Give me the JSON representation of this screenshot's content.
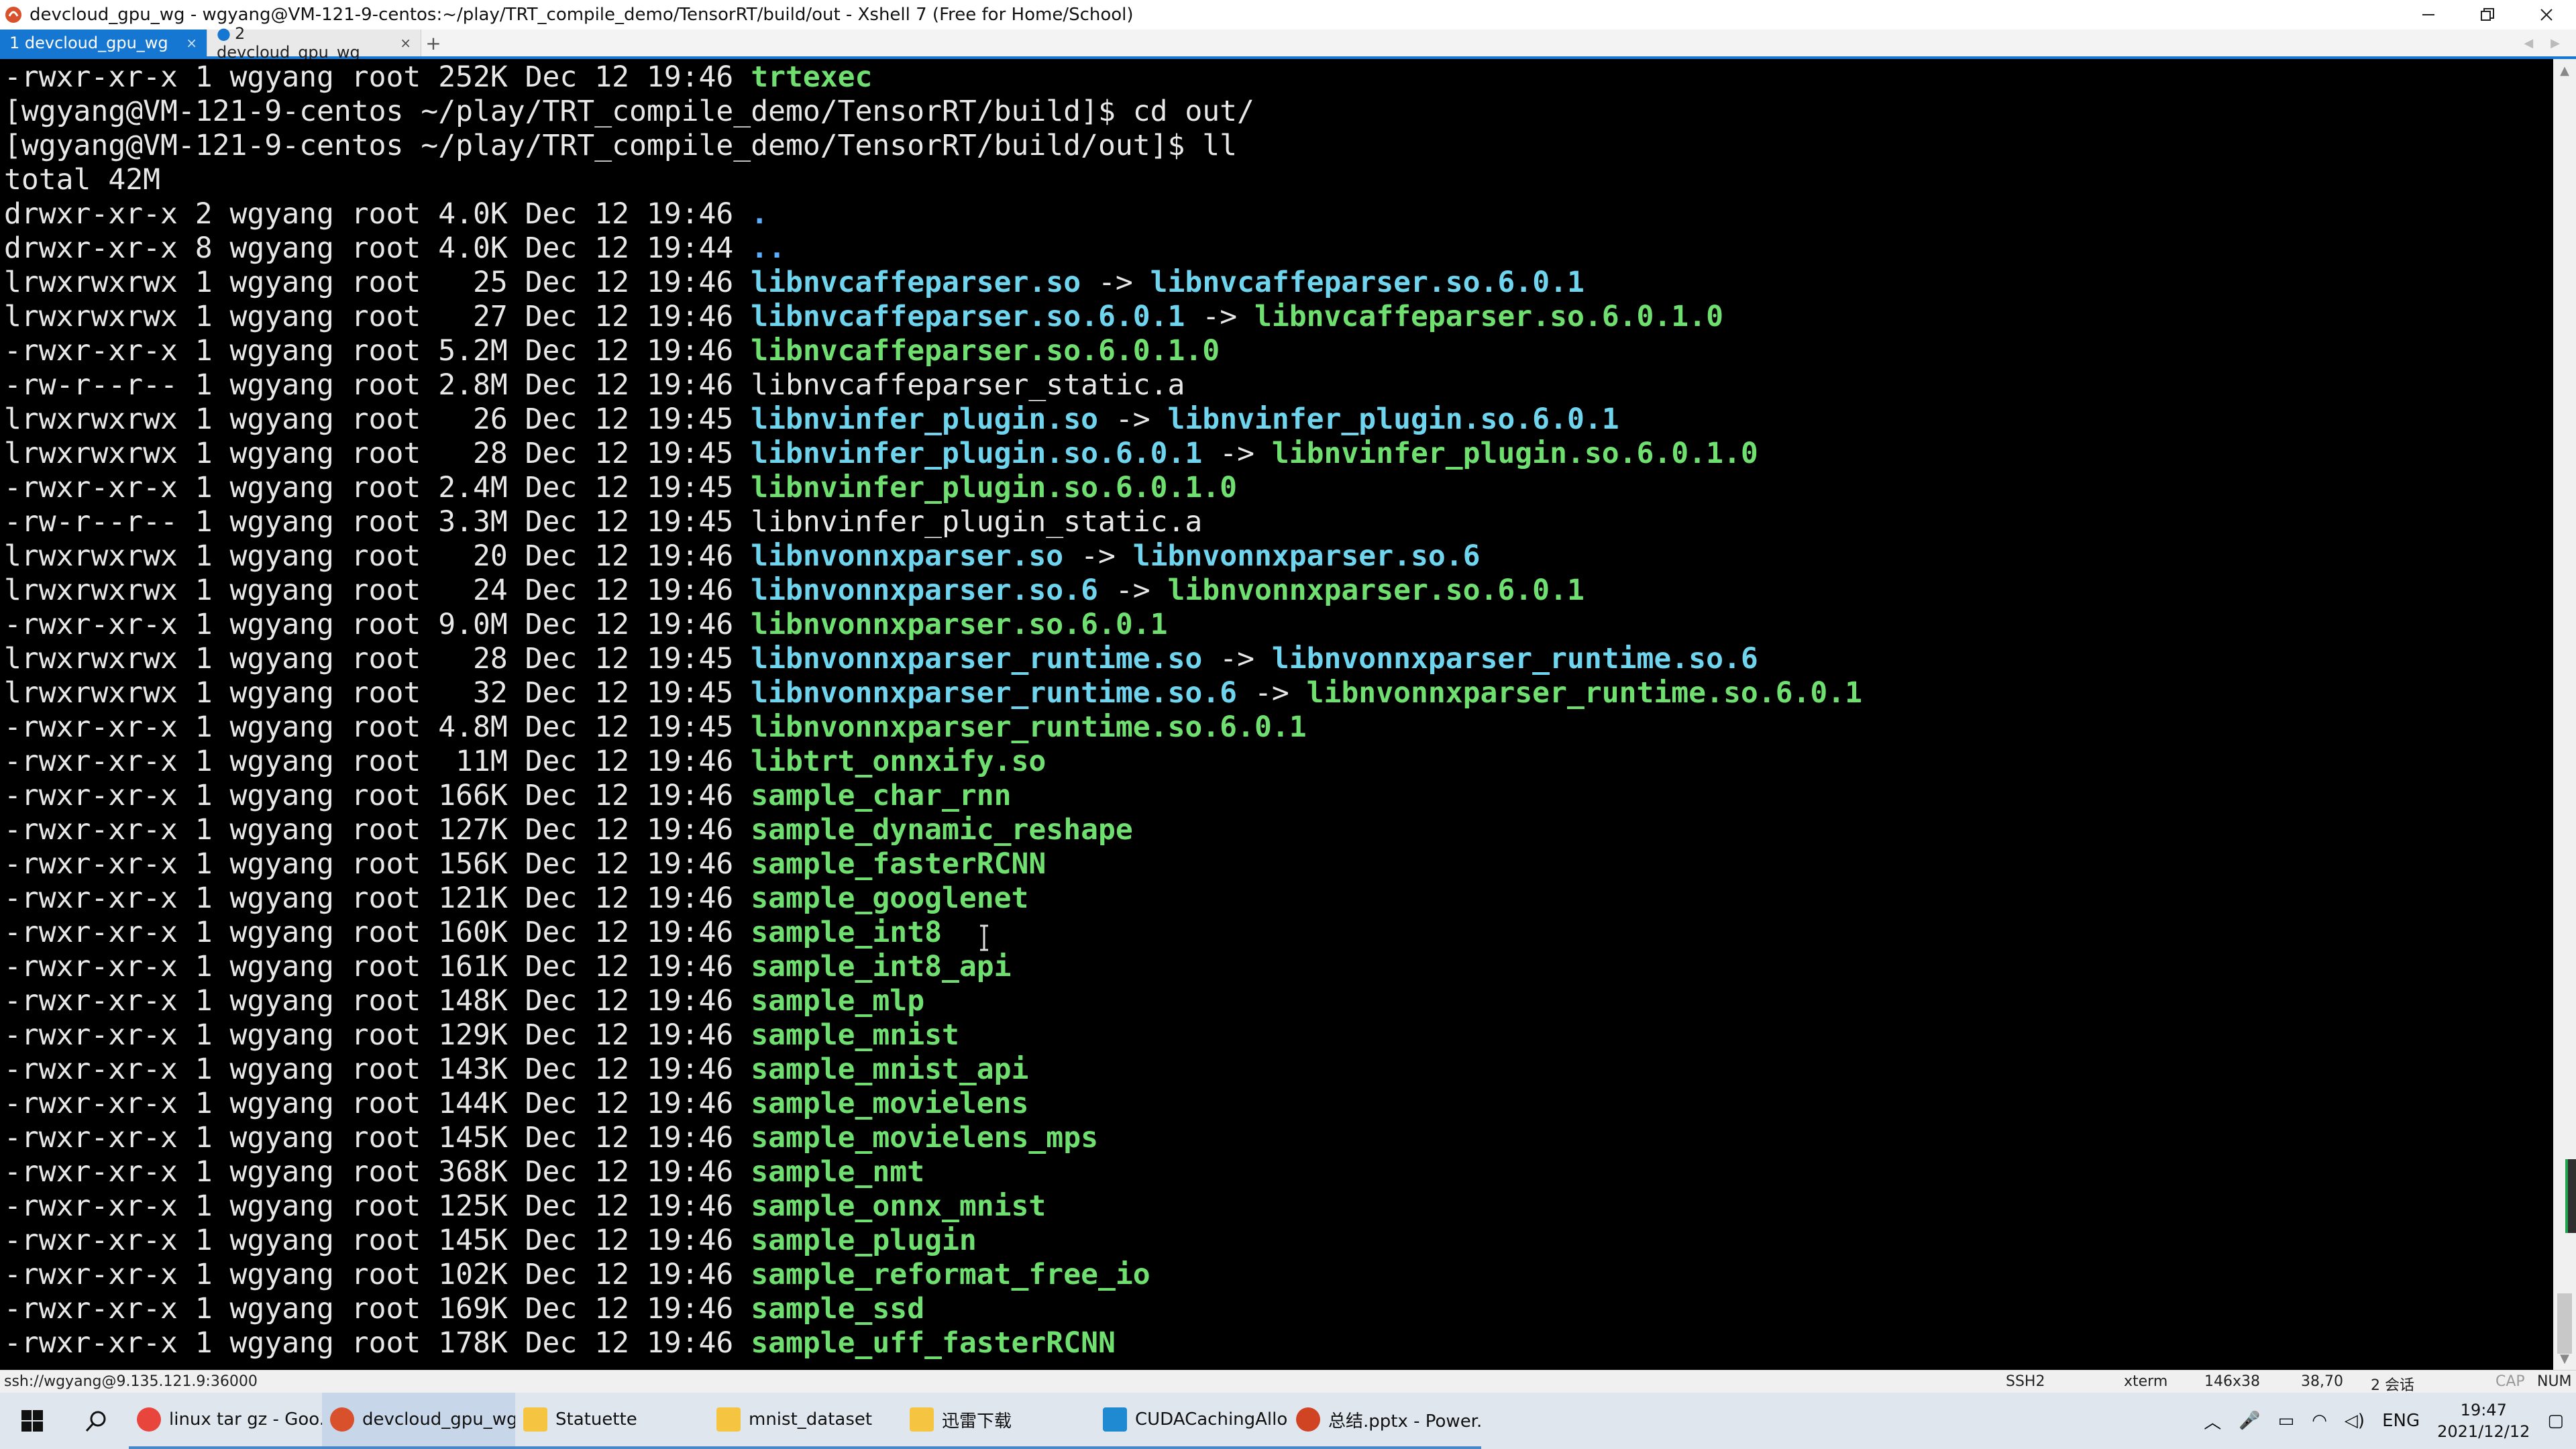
{
  "window": {
    "title": "devcloud_gpu_wg - wgyang@VM-121-9-centos:~/play/TRT_compile_demo/TensorRT/build/out - Xshell 7 (Free for Home/School)",
    "min_icon": "minimize-icon",
    "restore_icon": "restore-icon",
    "close_icon": "close-icon"
  },
  "tabs": [
    {
      "label": "1 devcloud_gpu_wg",
      "close": "×"
    },
    {
      "label": "2 devcloud_gpu_wg",
      "close": "×"
    }
  ],
  "tab_add": "+",
  "colors": {
    "dir": "#5ab0ff",
    "link": "#6fd4ee",
    "exe": "#6fe070",
    "tab_active": "#1677d2"
  },
  "terminal": {
    "lines": [
      {
        "prefix": "-rwxr-xr-x 1 wgyang root 252K Dec 12 19:46 ",
        "name": "trtexec",
        "kind": "exe"
      },
      {
        "prefix": "[wgyang@VM-121-9-centos ~/play/TRT_compile_demo/TensorRT/build]$ cd out/",
        "name": "",
        "kind": "plain"
      },
      {
        "prefix": "[wgyang@VM-121-9-centos ~/play/TRT_compile_demo/TensorRT/build/out]$ ll",
        "name": "",
        "kind": "plain"
      },
      {
        "prefix": "total 42M",
        "name": "",
        "kind": "plain"
      },
      {
        "prefix": "drwxr-xr-x 2 wgyang root 4.0K Dec 12 19:46 ",
        "name": ".",
        "kind": "dir"
      },
      {
        "prefix": "drwxr-xr-x 8 wgyang root 4.0K Dec 12 19:44 ",
        "name": "..",
        "kind": "dir"
      },
      {
        "prefix": "lrwxrwxrwx 1 wgyang root   25 Dec 12 19:46 ",
        "name": "libnvcaffeparser.so",
        "kind": "link",
        "target": "libnvcaffeparser.so.6.0.1",
        "target_kind": "link"
      },
      {
        "prefix": "lrwxrwxrwx 1 wgyang root   27 Dec 12 19:46 ",
        "name": "libnvcaffeparser.so.6.0.1",
        "kind": "link",
        "target": "libnvcaffeparser.so.6.0.1.0",
        "target_kind": "exe"
      },
      {
        "prefix": "-rwxr-xr-x 1 wgyang root 5.2M Dec 12 19:46 ",
        "name": "libnvcaffeparser.so.6.0.1.0",
        "kind": "exe"
      },
      {
        "prefix": "-rw-r--r-- 1 wgyang root 2.8M Dec 12 19:46 ",
        "name": "libnvcaffeparser_static.a",
        "kind": "plain"
      },
      {
        "prefix": "lrwxrwxrwx 1 wgyang root   26 Dec 12 19:45 ",
        "name": "libnvinfer_plugin.so",
        "kind": "link",
        "target": "libnvinfer_plugin.so.6.0.1",
        "target_kind": "link"
      },
      {
        "prefix": "lrwxrwxrwx 1 wgyang root   28 Dec 12 19:45 ",
        "name": "libnvinfer_plugin.so.6.0.1",
        "kind": "link",
        "target": "libnvinfer_plugin.so.6.0.1.0",
        "target_kind": "exe"
      },
      {
        "prefix": "-rwxr-xr-x 1 wgyang root 2.4M Dec 12 19:45 ",
        "name": "libnvinfer_plugin.so.6.0.1.0",
        "kind": "exe"
      },
      {
        "prefix": "-rw-r--r-- 1 wgyang root 3.3M Dec 12 19:45 ",
        "name": "libnvinfer_plugin_static.a",
        "kind": "plain"
      },
      {
        "prefix": "lrwxrwxrwx 1 wgyang root   20 Dec 12 19:46 ",
        "name": "libnvonnxparser.so",
        "kind": "link",
        "target": "libnvonnxparser.so.6",
        "target_kind": "link"
      },
      {
        "prefix": "lrwxrwxrwx 1 wgyang root   24 Dec 12 19:46 ",
        "name": "libnvonnxparser.so.6",
        "kind": "link",
        "target": "libnvonnxparser.so.6.0.1",
        "target_kind": "exe"
      },
      {
        "prefix": "-rwxr-xr-x 1 wgyang root 9.0M Dec 12 19:46 ",
        "name": "libnvonnxparser.so.6.0.1",
        "kind": "exe"
      },
      {
        "prefix": "lrwxrwxrwx 1 wgyang root   28 Dec 12 19:45 ",
        "name": "libnvonnxparser_runtime.so",
        "kind": "link",
        "target": "libnvonnxparser_runtime.so.6",
        "target_kind": "link"
      },
      {
        "prefix": "lrwxrwxrwx 1 wgyang root   32 Dec 12 19:45 ",
        "name": "libnvonnxparser_runtime.so.6",
        "kind": "link",
        "target": "libnvonnxparser_runtime.so.6.0.1",
        "target_kind": "exe"
      },
      {
        "prefix": "-rwxr-xr-x 1 wgyang root 4.8M Dec 12 19:45 ",
        "name": "libnvonnxparser_runtime.so.6.0.1",
        "kind": "exe"
      },
      {
        "prefix": "-rwxr-xr-x 1 wgyang root  11M Dec 12 19:46 ",
        "name": "libtrt_onnxify.so",
        "kind": "exe"
      },
      {
        "prefix": "-rwxr-xr-x 1 wgyang root 166K Dec 12 19:46 ",
        "name": "sample_char_rnn",
        "kind": "exe"
      },
      {
        "prefix": "-rwxr-xr-x 1 wgyang root 127K Dec 12 19:46 ",
        "name": "sample_dynamic_reshape",
        "kind": "exe"
      },
      {
        "prefix": "-rwxr-xr-x 1 wgyang root 156K Dec 12 19:46 ",
        "name": "sample_fasterRCNN",
        "kind": "exe"
      },
      {
        "prefix": "-rwxr-xr-x 1 wgyang root 121K Dec 12 19:46 ",
        "name": "sample_googlenet",
        "kind": "exe"
      },
      {
        "prefix": "-rwxr-xr-x 1 wgyang root 160K Dec 12 19:46 ",
        "name": "sample_int8",
        "kind": "exe"
      },
      {
        "prefix": "-rwxr-xr-x 1 wgyang root 161K Dec 12 19:46 ",
        "name": "sample_int8_api",
        "kind": "exe"
      },
      {
        "prefix": "-rwxr-xr-x 1 wgyang root 148K Dec 12 19:46 ",
        "name": "sample_mlp",
        "kind": "exe"
      },
      {
        "prefix": "-rwxr-xr-x 1 wgyang root 129K Dec 12 19:46 ",
        "name": "sample_mnist",
        "kind": "exe"
      },
      {
        "prefix": "-rwxr-xr-x 1 wgyang root 143K Dec 12 19:46 ",
        "name": "sample_mnist_api",
        "kind": "exe"
      },
      {
        "prefix": "-rwxr-xr-x 1 wgyang root 144K Dec 12 19:46 ",
        "name": "sample_movielens",
        "kind": "exe"
      },
      {
        "prefix": "-rwxr-xr-x 1 wgyang root 145K Dec 12 19:46 ",
        "name": "sample_movielens_mps",
        "kind": "exe"
      },
      {
        "prefix": "-rwxr-xr-x 1 wgyang root 368K Dec 12 19:46 ",
        "name": "sample_nmt",
        "kind": "exe"
      },
      {
        "prefix": "-rwxr-xr-x 1 wgyang root 125K Dec 12 19:46 ",
        "name": "sample_onnx_mnist",
        "kind": "exe"
      },
      {
        "prefix": "-rwxr-xr-x 1 wgyang root 145K Dec 12 19:46 ",
        "name": "sample_plugin",
        "kind": "exe"
      },
      {
        "prefix": "-rwxr-xr-x 1 wgyang root 102K Dec 12 19:46 ",
        "name": "sample_reformat_free_io",
        "kind": "exe"
      },
      {
        "prefix": "-rwxr-xr-x 1 wgyang root 169K Dec 12 19:46 ",
        "name": "sample_ssd",
        "kind": "exe"
      },
      {
        "prefix": "-rwxr-xr-x 1 wgyang root 178K Dec 12 19:46 ",
        "name": "sample_uff_fasterRCNN",
        "kind": "exe"
      }
    ],
    "arrow": " -> "
  },
  "statusbar": {
    "connection": "ssh://wgyang@9.135.121.9:36000",
    "protocol": "SSH2",
    "term": "xterm",
    "size": "146x38",
    "cursor_pos": "38,70",
    "sessions": "2 会话",
    "cap": "CAP",
    "num": "NUM"
  },
  "taskbar": {
    "apps": [
      {
        "label": "linux tar gz - Goo...",
        "icon": "chrome-icon",
        "color": "#e8453c"
      },
      {
        "label": "devcloud_gpu_wg...",
        "icon": "xshell-icon",
        "color": "#d9512c"
      },
      {
        "label": "Statuette",
        "icon": "folder-icon",
        "color": "#f5c542"
      },
      {
        "label": "mnist_dataset",
        "icon": "folder-icon",
        "color": "#f5c542"
      },
      {
        "label": "迅雷下载",
        "icon": "folder-icon",
        "color": "#f5c542"
      },
      {
        "label": "CUDACachingAllo...",
        "icon": "vscode-icon",
        "color": "#1f8ad2"
      },
      {
        "label": "总结.pptx - Power...",
        "icon": "powerpoint-icon",
        "color": "#d04423"
      }
    ],
    "lang": "ENG",
    "time": "19:47",
    "date": "2021/12/12"
  }
}
